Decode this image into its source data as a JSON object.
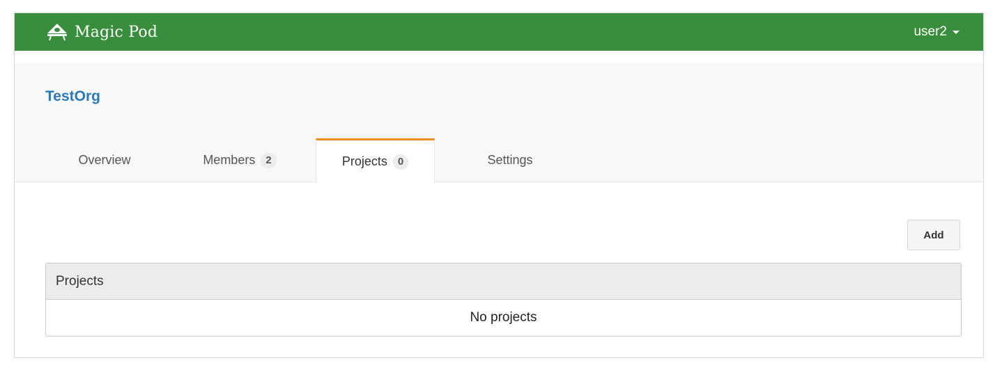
{
  "navbar": {
    "brand_name": "Magic Pod",
    "user_label": "user2",
    "background_color": "#388e3c",
    "brand_icon": "magic-pod-logo-icon",
    "caret_icon": "caret-down-icon"
  },
  "org": {
    "name": "TestOrg"
  },
  "tabs": [
    {
      "label": "Overview",
      "badge": null
    },
    {
      "label": "Members",
      "badge": "2"
    },
    {
      "label": "Projects",
      "badge": "0",
      "active": true
    },
    {
      "label": "Settings",
      "badge": null
    }
  ],
  "active_tab_color": "#f28a1f",
  "actions": {
    "add_label": "Add"
  },
  "projects_panel": {
    "heading": "Projects",
    "empty_text": "No projects"
  }
}
